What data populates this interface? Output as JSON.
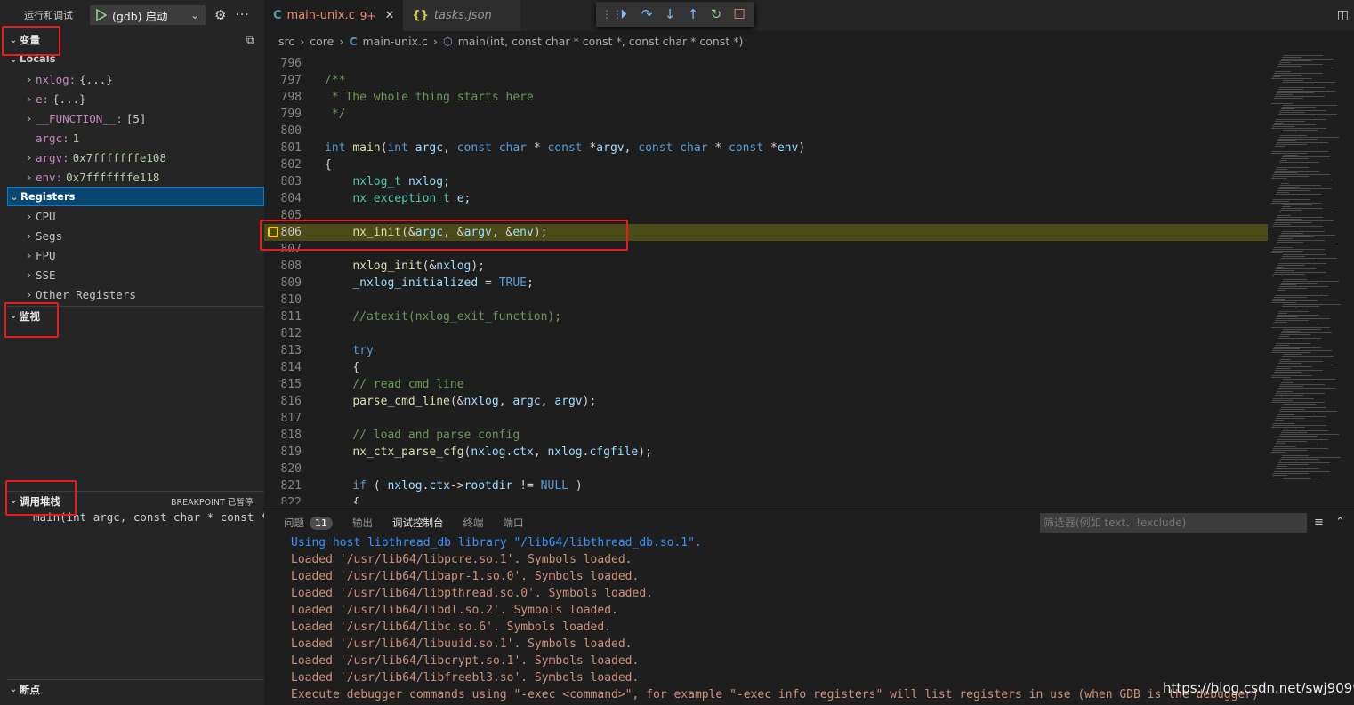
{
  "sidebar": {
    "title": "运行和调试",
    "config": "(gdb) 启动",
    "sections": {
      "variables": "变量",
      "locals": "Locals",
      "registers": "Registers",
      "watch": "监视",
      "callstack": "调用堆栈",
      "breakpoints": "断点"
    },
    "locals": [
      {
        "name": "nxlog:",
        "value": "{...}",
        "expandable": true
      },
      {
        "name": "e:",
        "value": "{...}",
        "expandable": true
      },
      {
        "name": "__FUNCTION__:",
        "value": "[5]",
        "expandable": true
      },
      {
        "name": "argc:",
        "value": "1",
        "expandable": false
      },
      {
        "name": "argv:",
        "value": "0x7fffffffe108",
        "expandable": true
      },
      {
        "name": "env:",
        "value": "0x7fffffffe118",
        "expandable": true
      }
    ],
    "registers": [
      "CPU",
      "Segs",
      "FPU",
      "SSE",
      "Other Registers"
    ],
    "callstack_status": "BREAKPOINT 已暂停",
    "callstack_frame": "main(int argc, const char * const * a"
  },
  "tabs": [
    {
      "label": "main-unix.c",
      "badge": "9+",
      "active": true
    },
    {
      "label": "tasks.json",
      "active": false
    }
  ],
  "breadcrumb": [
    "src",
    "core",
    "main-unix.c",
    "main(int, const char * const *, const char * const *)"
  ],
  "code_lines": [
    {
      "n": "796",
      "text": ""
    },
    {
      "n": "797",
      "text": "/**"
    },
    {
      "n": "798",
      "text": " * The whole thing starts here"
    },
    {
      "n": "799",
      "text": " */"
    },
    {
      "n": "800",
      "text": ""
    },
    {
      "n": "801",
      "text": "int main(int argc, const char * const *argv, const char * const *env)"
    },
    {
      "n": "802",
      "text": "{"
    },
    {
      "n": "803",
      "text": "    nxlog_t nxlog;"
    },
    {
      "n": "804",
      "text": "    nx_exception_t e;"
    },
    {
      "n": "805",
      "text": ""
    },
    {
      "n": "806",
      "text": "    nx_init(&argc, &argv, &env);"
    },
    {
      "n": "807",
      "text": ""
    },
    {
      "n": "808",
      "text": "    nxlog_init(&nxlog);"
    },
    {
      "n": "809",
      "text": "    _nxlog_initialized = TRUE;"
    },
    {
      "n": "810",
      "text": ""
    },
    {
      "n": "811",
      "text": "    //atexit(nxlog_exit_function);"
    },
    {
      "n": "812",
      "text": ""
    },
    {
      "n": "813",
      "text": "    try"
    },
    {
      "n": "814",
      "text": "    {"
    },
    {
      "n": "815",
      "text": "    // read cmd line"
    },
    {
      "n": "816",
      "text": "    parse_cmd_line(&nxlog, argc, argv);"
    },
    {
      "n": "817",
      "text": ""
    },
    {
      "n": "818",
      "text": "    // load and parse config"
    },
    {
      "n": "819",
      "text": "    nx_ctx_parse_cfg(nxlog.ctx, nxlog.cfgfile);"
    },
    {
      "n": "820",
      "text": ""
    },
    {
      "n": "821",
      "text": "    if ( nxlog.ctx->rootdir != NULL )"
    },
    {
      "n": "822",
      "text": "    {"
    }
  ],
  "current_line": "806",
  "panel": {
    "tabs": [
      "问题",
      "输出",
      "调试控制台",
      "终端",
      "端口"
    ],
    "problems_count": "11",
    "active_tab": "调试控制台",
    "filter_placeholder": "筛选器(例如 text、!exclude)",
    "console": [
      "Using host libthread_db library \"/lib64/libthread_db.so.1\".",
      "Loaded '/usr/lib64/libpcre.so.1'. Symbols loaded.",
      "Loaded '/usr/lib64/libapr-1.so.0'. Symbols loaded.",
      "Loaded '/usr/lib64/libpthread.so.0'. Symbols loaded.",
      "Loaded '/usr/lib64/libdl.so.2'. Symbols loaded.",
      "Loaded '/usr/lib64/libc.so.6'. Symbols loaded.",
      "Loaded '/usr/lib64/libuuid.so.1'. Symbols loaded.",
      "Loaded '/usr/lib64/libcrypt.so.1'. Symbols loaded.",
      "Loaded '/usr/lib64/libfreebl3.so'. Symbols loaded.",
      "Execute debugger commands using \"-exec <command>\", for example \"-exec info registers\" will list registers in use (when GDB is the debugger)"
    ]
  },
  "watermark": "https://blog.csdn.net/swj9099",
  "colors": {
    "accent": "#007acc",
    "annotation_box": "#e81c1c",
    "current_line": "#4b4b18"
  }
}
